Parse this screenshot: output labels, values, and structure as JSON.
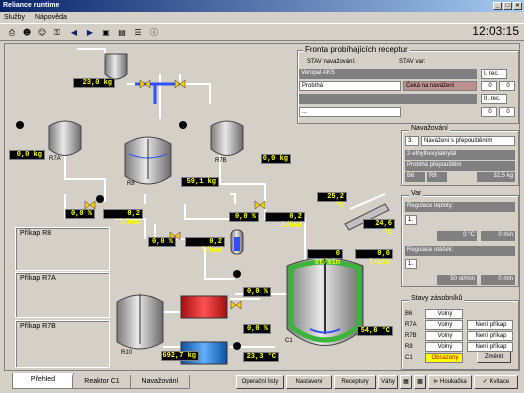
{
  "window": {
    "title": "Reliance runtime"
  },
  "menu": [
    "Služby",
    "Nápověda"
  ],
  "clock": "12:03:15",
  "canvas": {
    "tanks": {
      "tank1": "23,0 kg",
      "r7a": "0,0 kg",
      "r8": "59,1 kg",
      "r7b": "0,0 kg",
      "r10": "692,7 kg",
      "c1": "C1"
    },
    "tank_labels": {
      "r7a": "R7A",
      "r8": "R8",
      "r7b": "R7B",
      "r10": "R10",
      "c1": "C1"
    },
    "flows": {
      "f1_pct": "0,0 %",
      "f1_lh": "0,2 l/hod",
      "f2_pct": "0,0 %",
      "f2_lh": "0,2 l/hod",
      "f3_pct": "0,0 %",
      "f3_lh": "0,2 l/hod"
    },
    "reactor": {
      "temp_top": "25,2 °C",
      "temp_right": "24,6 °C",
      "rpm": "0 ot/min",
      "lmin": "0,0 l/min",
      "jacket_temp": "54,8 °C",
      "pct_top": "0,0 %",
      "pct_bot": "0,0 %",
      "temp_bot": "23,3 °C"
    },
    "left_sections": [
      "Příkap R8",
      "Příkap R7A",
      "Příkap R7B"
    ]
  },
  "queue": {
    "title": "Fronta probíhajících receptur",
    "col1": "STAV navažování:",
    "col2": "STAV var:",
    "row1_name": "Veropal AKS",
    "row1_state": "Probíhá",
    "row1_wait": "Čeká na navážení",
    "row1_rec": "I. rec.",
    "row1_a": "0",
    "row1_b": "0",
    "row2_rec": "II. rec.",
    "row2_a": "0",
    "row2_b": "0",
    "dots": "..."
  },
  "weighing": {
    "title": "Navažování",
    "num": "3.",
    "status": "Navážení s přepouštěním",
    "item1": "2-ethylhexylakrylát",
    "item2": "Probíhá přepouštění",
    "b6": "B6",
    "r8": "R8",
    "kg": "32,5 kg"
  },
  "var": {
    "title": "Var",
    "temp_title": "Regulace teploty:",
    "temp_num": "1.",
    "temp_val": "0 °C",
    "temp_min": "0 min",
    "rpm_title": "Regulace otáček:",
    "rpm_num": "1.",
    "rpm_val": "50 ot/min",
    "rpm_min": "0 min"
  },
  "tanks_state": {
    "title": "Stavy zásobníků",
    "rows": [
      {
        "n": "B6",
        "s": "Volný",
        "a": ""
      },
      {
        "n": "R7A",
        "s": "Volný",
        "a": "Není příkap"
      },
      {
        "n": "R7B",
        "s": "Volný",
        "a": "Není příkap"
      },
      {
        "n": "R8",
        "s": "Volný",
        "a": "Není příkap"
      },
      {
        "n": "C1",
        "s": "Obsazený",
        "a": ""
      }
    ],
    "change": "Změnit"
  },
  "tabs": [
    "Přehled",
    "Reaktor C1",
    "Navažování"
  ],
  "bottom_buttons": [
    "Operační listy",
    "Nastavení",
    "Receptury",
    "Váhy",
    "Houkačka",
    "Kvitace"
  ],
  "colors": {
    "display_bg": "#000000",
    "display_fg": "#ffff00",
    "tank_gray": "#b0b0b0",
    "green": "#3cb43c",
    "red": "#e02020",
    "blue": "#2080e0"
  }
}
